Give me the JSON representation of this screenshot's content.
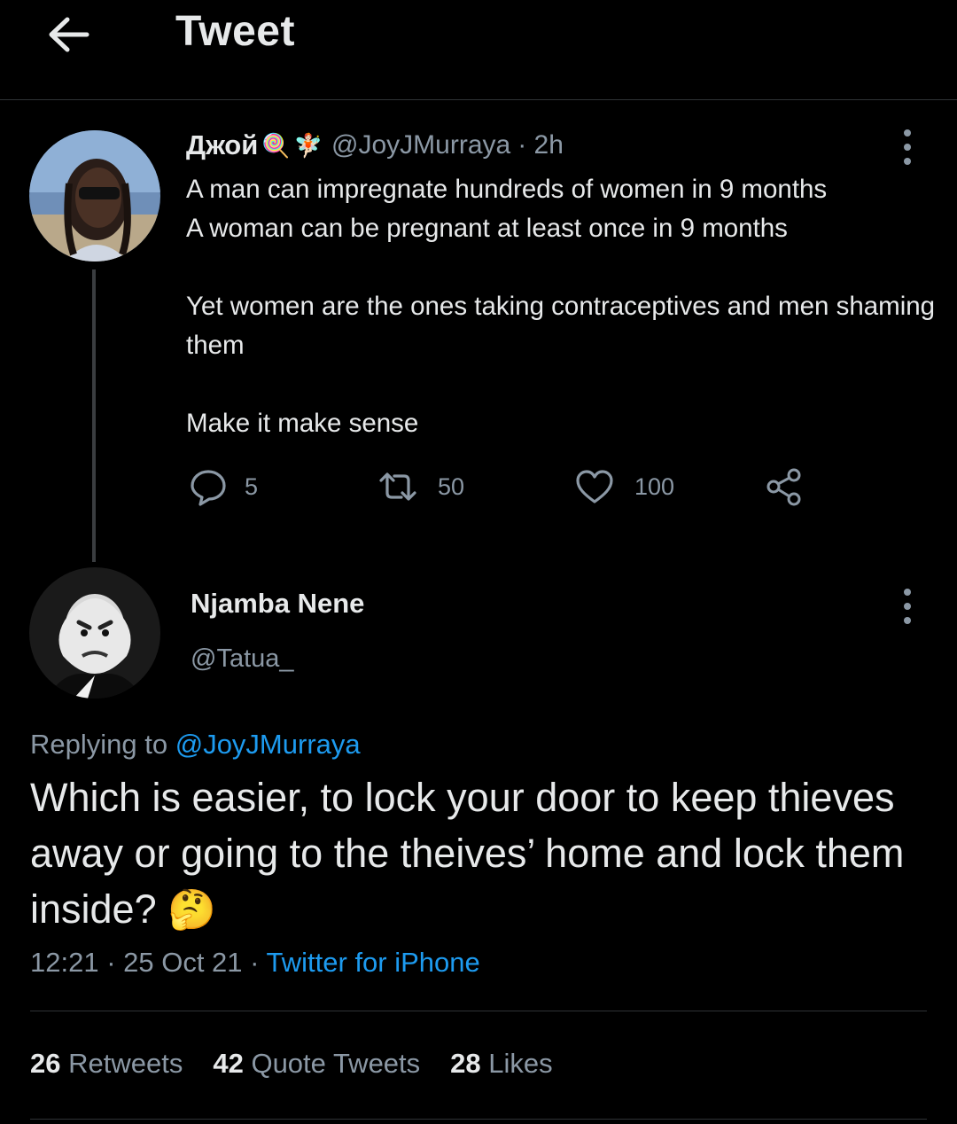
{
  "header": {
    "title": "Tweet",
    "back_icon": "arrow-left-icon"
  },
  "parent_tweet": {
    "display_name": "Джой",
    "name_emojis": [
      "🍭",
      "🧚🏻"
    ],
    "handle": "@JoyJMurraya",
    "time": "· 2h",
    "text": "A man can impregnate hundreds of women in 9 months\nA woman can be pregnant at least once in 9 months\n\nYet women are the ones taking contraceptives and men shaming them\n\nMake it make sense",
    "actions": {
      "replies": "5",
      "retweets": "50",
      "likes": "100"
    }
  },
  "reply_tweet": {
    "display_name": "Njamba Nene",
    "handle": "@Tatua_",
    "replying_prefix": "Replying to",
    "replying_to": "@JoyJMurraya",
    "text": "Which is easier, to lock your door to keep thieves away or going to the theives’ home and lock them inside?",
    "emoji": "🤔",
    "timestamp": "12:21 · 25 Oct 21 ·",
    "source": "Twitter for iPhone",
    "stats": {
      "retweets_count": "26",
      "retweets_label": "Retweets",
      "quotes_count": "42",
      "quotes_label": "Quote Tweets",
      "likes_count": "28",
      "likes_label": "Likes"
    }
  },
  "colors": {
    "background": "#000000",
    "text": "#e7e9ea",
    "muted": "#8b98a5",
    "link": "#1d9bf0",
    "divider": "#2f3336"
  }
}
